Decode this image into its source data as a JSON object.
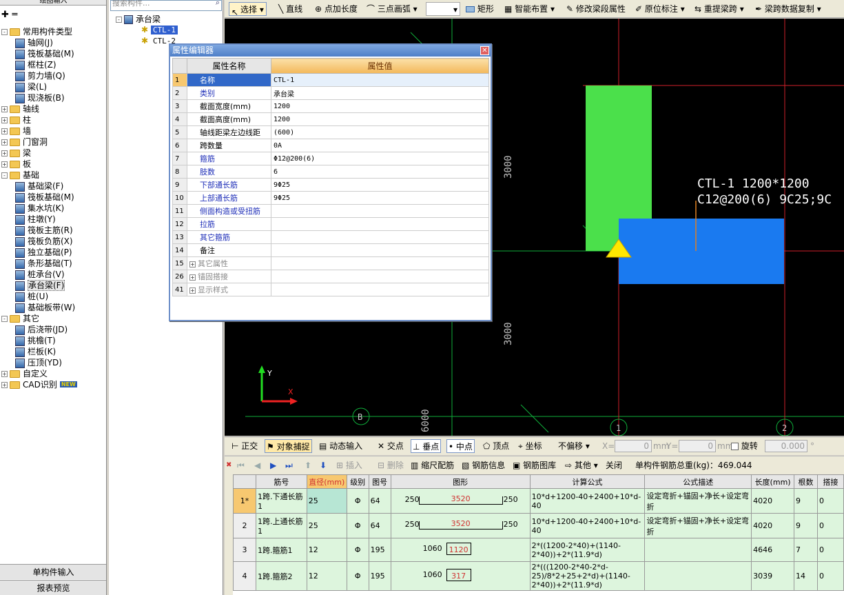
{
  "left_panel": {
    "top_label": "绘图输入",
    "tree": [
      {
        "label": "常用构件类型",
        "level": 0,
        "exp": "-",
        "type": "folder"
      },
      {
        "label": "轴网(J)",
        "level": 1,
        "type": "item"
      },
      {
        "label": "筏板基础(M)",
        "level": 1,
        "type": "item"
      },
      {
        "label": "框柱(Z)",
        "level": 1,
        "type": "item"
      },
      {
        "label": "剪力墙(Q)",
        "level": 1,
        "type": "item"
      },
      {
        "label": "梁(L)",
        "level": 1,
        "type": "item"
      },
      {
        "label": "现浇板(B)",
        "level": 1,
        "type": "item"
      },
      {
        "label": "轴线",
        "level": 0,
        "exp": "+",
        "type": "folder"
      },
      {
        "label": "柱",
        "level": 0,
        "exp": "+",
        "type": "folder"
      },
      {
        "label": "墙",
        "level": 0,
        "exp": "+",
        "type": "folder"
      },
      {
        "label": "门窗洞",
        "level": 0,
        "exp": "+",
        "type": "folder"
      },
      {
        "label": "梁",
        "level": 0,
        "exp": "+",
        "type": "folder"
      },
      {
        "label": "板",
        "level": 0,
        "exp": "+",
        "type": "folder"
      },
      {
        "label": "基础",
        "level": 0,
        "exp": "-",
        "type": "folder"
      },
      {
        "label": "基础梁(F)",
        "level": 1,
        "type": "item"
      },
      {
        "label": "筏板基础(M)",
        "level": 1,
        "type": "item"
      },
      {
        "label": "集水坑(K)",
        "level": 1,
        "type": "item"
      },
      {
        "label": "柱墩(Y)",
        "level": 1,
        "type": "item"
      },
      {
        "label": "筏板主筋(R)",
        "level": 1,
        "type": "item"
      },
      {
        "label": "筏板负筋(X)",
        "level": 1,
        "type": "item"
      },
      {
        "label": "独立基础(P)",
        "level": 1,
        "type": "item"
      },
      {
        "label": "条形基础(T)",
        "level": 1,
        "type": "item"
      },
      {
        "label": "桩承台(V)",
        "level": 1,
        "type": "item"
      },
      {
        "label": "承台梁(F)",
        "level": 1,
        "type": "item",
        "selected": true
      },
      {
        "label": "桩(U)",
        "level": 1,
        "type": "item"
      },
      {
        "label": "基础板带(W)",
        "level": 1,
        "type": "item"
      },
      {
        "label": "其它",
        "level": 0,
        "exp": "-",
        "type": "folder"
      },
      {
        "label": "后浇带(JD)",
        "level": 1,
        "type": "item"
      },
      {
        "label": "挑檐(T)",
        "level": 1,
        "type": "item"
      },
      {
        "label": "栏板(K)",
        "level": 1,
        "type": "item"
      },
      {
        "label": "压顶(YD)",
        "level": 1,
        "type": "item"
      },
      {
        "label": "自定义",
        "level": 0,
        "exp": "+",
        "type": "folder"
      },
      {
        "label": "CAD识别",
        "level": 0,
        "exp": "+",
        "type": "folder",
        "badge": "NEW"
      }
    ],
    "bottom1": "单构件输入",
    "bottom2": "报表预览"
  },
  "mid_panel": {
    "search_placeholder": "搜索构件...",
    "root": "承台梁",
    "items": [
      "CTL-1",
      "CTL-2"
    ]
  },
  "toolbar": {
    "items": [
      "选择",
      "直线",
      "点加长度",
      "三点画弧",
      "矩形",
      "智能布置",
      "修改梁段属性",
      "原位标注",
      "重提梁跨",
      "梁跨数据复制"
    ]
  },
  "canvas": {
    "dim_3000_a": "3000",
    "dim_3000_b": "3000",
    "dim_6000": "6000",
    "label_line1": "CTL-1 1200*1200",
    "label_line2": "C12@200(6) 9C25;9C",
    "axis_B": "B",
    "axis_1": "1",
    "axis_2": "2",
    "y_label": "Y",
    "x_label": "X"
  },
  "snapbar": {
    "items": [
      "正交",
      "对象捕捉",
      "动态输入",
      "交点",
      "垂点",
      "中点",
      "顶点",
      "坐标"
    ],
    "offset": "不偏移",
    "x_label": "X=",
    "x_value": "0",
    "y_label": "Y=",
    "y_value": "0",
    "unit": "mm",
    "rotate": "旋转",
    "rotate_value": "0.000",
    "degree": "°"
  },
  "grid_toolbar": {
    "items": [
      "插入",
      "删除",
      "缩尺配筋",
      "钢筋信息",
      "钢筋图库",
      "其他",
      "关闭"
    ],
    "total": "单构件钢筋总重(kg)：469.044"
  },
  "rebar_table": {
    "headers": [
      "",
      "筋号",
      "直径(mm)",
      "级别",
      "图号",
      "图形",
      "计算公式",
      "公式描述",
      "长度(mm)",
      "根数",
      "搭接"
    ],
    "rows": [
      {
        "idx": "1*",
        "name": "1跨.下通长筋1",
        "dia": "25",
        "grade": "Φ",
        "fig": "64",
        "shape_left": "250",
        "shape_mid": "3520",
        "shape_right": "250",
        "formula": "10*d+1200-40+2400+10*d-40",
        "desc": "设定弯折+锚固+净长+设定弯折",
        "len": "4020",
        "count": "9",
        "lap": "0"
      },
      {
        "idx": "2",
        "name": "1跨.上通长筋1",
        "dia": "25",
        "grade": "Φ",
        "fig": "64",
        "shape_left": "250",
        "shape_mid": "3520",
        "shape_right": "250",
        "formula": "10*d+1200-40+2400+10*d-40",
        "desc": "设定弯折+锚固+净长+设定弯折",
        "len": "4020",
        "count": "9",
        "lap": "0"
      },
      {
        "idx": "3",
        "name": "1跨.箍筋1",
        "dia": "12",
        "grade": "Φ",
        "fig": "195",
        "shape_left": "1060",
        "shape_mid": "1120",
        "shape_right": "",
        "formula": "2*((1200-2*40)+(1140-2*40))+2*(11.9*d)",
        "desc": "",
        "len": "4646",
        "count": "7",
        "lap": "0"
      },
      {
        "idx": "4",
        "name": "1跨.箍筋2",
        "dia": "12",
        "grade": "Φ",
        "fig": "195",
        "shape_left": "1060",
        "shape_mid": "317",
        "shape_right": "",
        "formula": "2*(((1200-2*40-2*d-25)/8*2+25+2*d)+(1140-2*40))+2*(11.9*d)",
        "desc": "",
        "len": "3039",
        "count": "14",
        "lap": "0"
      }
    ]
  },
  "property_editor": {
    "title": "属性编辑器",
    "col_name": "属性名称",
    "col_value": "属性值",
    "rows": [
      {
        "n": "1",
        "name": "名称",
        "value": "CTL-1",
        "style": "selected"
      },
      {
        "n": "2",
        "name": "类别",
        "value": "承台梁",
        "style": "blue"
      },
      {
        "n": "3",
        "name": "截面宽度(mm)",
        "value": "1200",
        "style": ""
      },
      {
        "n": "4",
        "name": "截面高度(mm)",
        "value": "1200",
        "style": ""
      },
      {
        "n": "5",
        "name": "轴线距梁左边线距",
        "value": "(600)",
        "style": ""
      },
      {
        "n": "6",
        "name": "跨数量",
        "value": "0A",
        "style": ""
      },
      {
        "n": "7",
        "name": "箍筋",
        "value": "Φ12@200(6)",
        "style": "blue"
      },
      {
        "n": "8",
        "name": "肢数",
        "value": "6",
        "style": "blue"
      },
      {
        "n": "9",
        "name": "下部通长筋",
        "value": "9Φ25",
        "style": "blue"
      },
      {
        "n": "10",
        "name": "上部通长筋",
        "value": "9Φ25",
        "style": "blue"
      },
      {
        "n": "11",
        "name": "侧面构造或受扭筋",
        "value": "",
        "style": "blue"
      },
      {
        "n": "12",
        "name": "拉筋",
        "value": "",
        "style": "blue"
      },
      {
        "n": "13",
        "name": "其它箍筋",
        "value": "",
        "style": "blue"
      },
      {
        "n": "14",
        "name": "备注",
        "value": "",
        "style": ""
      },
      {
        "n": "15",
        "name": "其它属性",
        "value": "",
        "style": "group"
      },
      {
        "n": "26",
        "name": "锚固搭接",
        "value": "",
        "style": "group"
      },
      {
        "n": "41",
        "name": "显示样式",
        "value": "",
        "style": "group"
      }
    ]
  },
  "colors": {
    "canvas_bg": "#000000",
    "grid_green": "#0fae3a",
    "grid_red": "#d0202a",
    "column_green": "#4be04b",
    "beam_blue": "#1a7af0",
    "accent_header": "#f7c870"
  }
}
